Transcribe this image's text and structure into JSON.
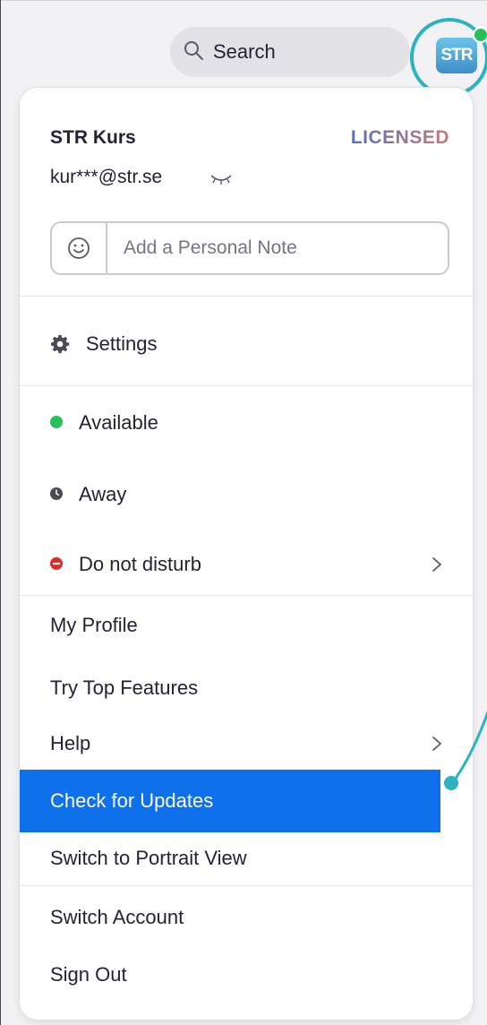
{
  "header": {
    "search_label": "Search",
    "avatar_initials": "STR"
  },
  "profile": {
    "name": "STR Kurs",
    "license": "LICENSED",
    "email": "kur***@str.se",
    "note_placeholder": "Add a Personal Note"
  },
  "menu": {
    "settings": "Settings",
    "status": {
      "available": "Available",
      "away": "Away",
      "do_not_disturb": "Do not disturb"
    },
    "my_profile": "My Profile",
    "try_top_features": "Try Top Features",
    "help": "Help",
    "check_for_updates": "Check for Updates",
    "switch_portrait": "Switch to Portrait View",
    "switch_account": "Switch Account",
    "sign_out": "Sign Out"
  },
  "colors": {
    "accent_blue": "#0e71eb",
    "callout_teal": "#2bb3c0",
    "available_green": "#27c05a",
    "away_gray": "#5c5c66",
    "dnd_red": "#e02828",
    "licensed_gradient_start": "#5a6fc0",
    "licensed_gradient_end": "#c87a78"
  }
}
